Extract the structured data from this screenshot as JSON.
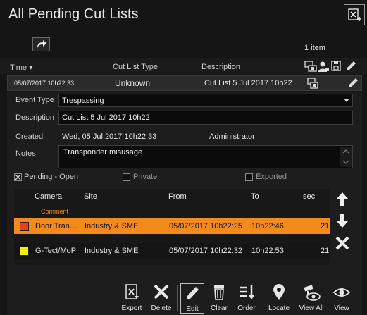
{
  "window": {
    "title": "All Pending Cut Lists",
    "item_count": "1 item"
  },
  "list": {
    "columns": [
      "Time ▾",
      "Cut List Type",
      "Description"
    ],
    "selected_row": {
      "time": "05/07/2017 10h22:33",
      "type": "Unknown",
      "description": "Cut List 5 Jul 2017 10h22"
    }
  },
  "detail": {
    "event_type_label": "Event Type",
    "event_type_value": "Trespassing",
    "description_label": "Description",
    "description_value": "Cut List 5 Jul 2017 10h22",
    "created_label": "Created",
    "created_value": "Wed, 05 Jul 2017  10h22:33",
    "created_by": "Administrator",
    "notes_label": "Notes",
    "notes_value": "Transponder misusage",
    "checkboxes": [
      {
        "label": "Pending - Open",
        "checked": true
      },
      {
        "label": "Private",
        "checked": false
      },
      {
        "label": "Exported",
        "checked": false
      }
    ]
  },
  "camera_table": {
    "columns": [
      "Camera",
      "Site",
      "From",
      "To",
      "sec"
    ],
    "subheader": "Comment",
    "rows": [
      {
        "camera": "Door Tran…",
        "site": "Industry & SME",
        "from": "05/07/2017 10h22:25",
        "to": "10h22:46",
        "sec": "21",
        "color": "#e8401c",
        "selected": true
      },
      {
        "camera": "G-Tect/MoP",
        "site": "Industry & SME",
        "from": "05/07/2017 10h22:32",
        "to": "10h22:53",
        "sec": "21",
        "color": "#f4f000",
        "selected": false
      }
    ]
  },
  "toolbar": {
    "export": "Export",
    "delete": "Delete",
    "edit": "Edit",
    "clear": "Clear",
    "order": "Order",
    "locate": "Locate",
    "view_all": "View All",
    "view": "View"
  },
  "colors": {
    "highlight": "#f28a1c",
    "background": "#151515"
  }
}
